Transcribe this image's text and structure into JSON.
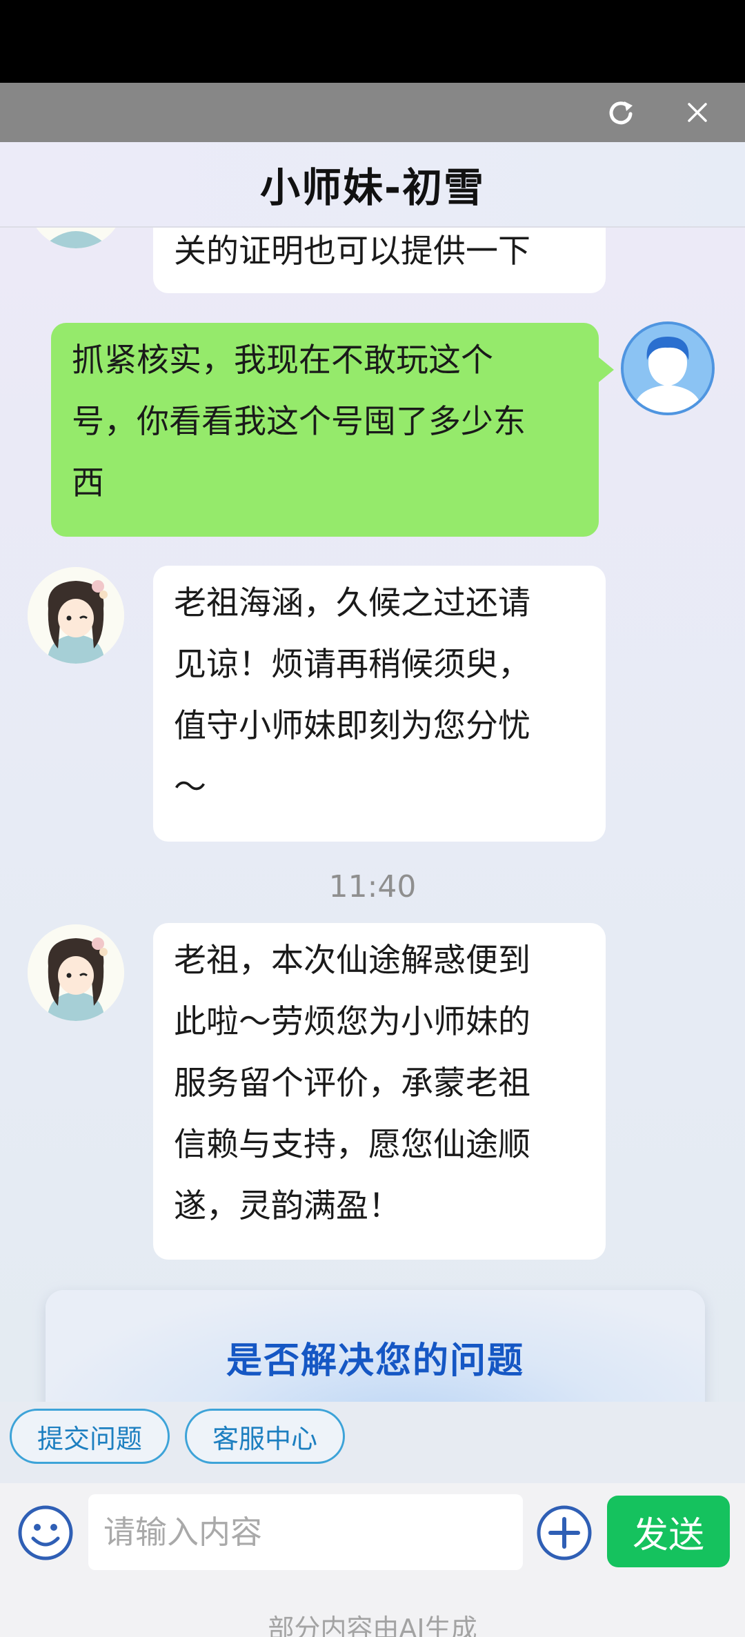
{
  "window": {
    "refresh_icon": "refresh-icon",
    "close_icon": "close-icon"
  },
  "header": {
    "title": "小师妹-初雪"
  },
  "messages": [
    {
      "role": "bot",
      "lines": [
        "关的证明也可以提供一下"
      ]
    },
    {
      "role": "user",
      "lines": [
        "抓紧核实，我现在不敢玩这个",
        "号，你看看我这个号囤了多少东",
        "西"
      ]
    },
    {
      "role": "bot",
      "lines": [
        "老祖海涵，久候之过还请",
        "见谅！烦请再稍候须臾，",
        "值守小师妹即刻为您分忧",
        "～"
      ]
    },
    {
      "role": "time",
      "text": "11:40"
    },
    {
      "role": "bot",
      "lines": [
        "老祖，本次仙途解惑便到",
        "此啦～劳烦您为小师妹的",
        "服务留个评价，承蒙老祖",
        "信赖与支持，愿您仙途顺",
        "遂，灵韵满盈！"
      ]
    }
  ],
  "resolve_card": {
    "title": "是否解决您的问题"
  },
  "quick_actions": [
    "提交问题",
    "客服中心"
  ],
  "composer": {
    "placeholder": "请输入内容",
    "send_label": "发送",
    "emoji_icon": "emoji-icon",
    "add_icon": "plus-circle-icon"
  },
  "footer_note": "部分内容由AI生成",
  "colors": {
    "user_bubble": "#95ea6b",
    "send_button": "#15c25e",
    "accent_blue": "#1557c4",
    "chip_border": "#3da3d8"
  }
}
